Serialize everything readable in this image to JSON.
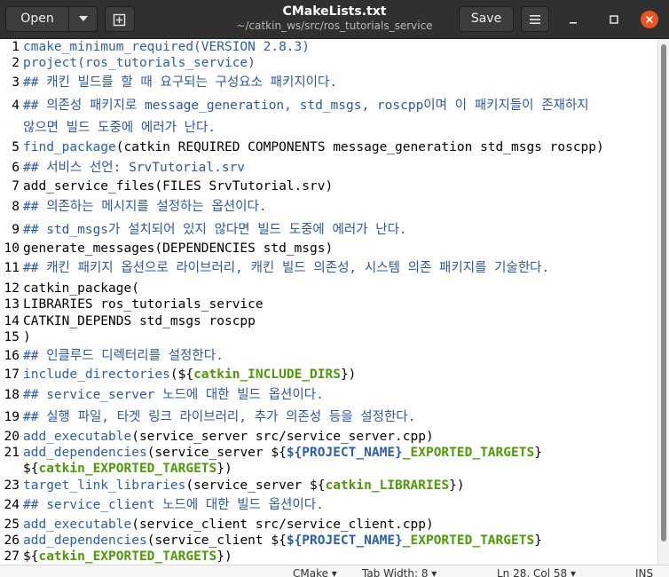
{
  "header": {
    "open_label": "Open",
    "save_label": "Save",
    "title": "CMakeLists.txt",
    "subtitle": "~/catkin_ws/src/ros_tutorials_service"
  },
  "icons": [
    "chevron-down-icon",
    "new-tab-icon",
    "hamburger-menu-icon",
    "minimize-icon",
    "maximize-icon",
    "close-icon"
  ],
  "colors": {
    "headerbar": "#303030",
    "keyword": "#2a5fb0",
    "variable": "#4e9a06",
    "close": "#e95420"
  },
  "editor": {
    "lines": [
      {
        "n": "1",
        "t": "cmake_minimum_required(VERSION 2.8.3)"
      },
      {
        "n": "2",
        "t": "project(ros_tutorials_service)"
      },
      {
        "n": "3",
        "t": "## 캐킨 빌드를 할 때 요구되는 구성요소 패키지이다."
      },
      {
        "n": "4",
        "t": "## 의존성 패키지로 message_generation, std_msgs, roscpp이며 이 패키지들이 존재하지"
      },
      {
        "n": "",
        "t": "않으면 빌드 도중에 에러가 난다."
      },
      {
        "n": "5",
        "t": "find_package(catkin REQUIRED COMPONENTS message_generation std_msgs roscpp)"
      },
      {
        "n": "6",
        "t": "## 서비스 선언: SrvTutorial.srv"
      },
      {
        "n": "7",
        "t": "add_service_files(FILES SrvTutorial.srv)"
      },
      {
        "n": "8",
        "t": "## 의존하는 메시지를 설정하는 옵션이다."
      },
      {
        "n": "9",
        "t": "## std_msgs가 설치되어 있지 않다면 빌드 도중에 에러가 난다."
      },
      {
        "n": "10",
        "t": "generate_messages(DEPENDENCIES std_msgs)"
      },
      {
        "n": "11",
        "t": "## 캐킨 패키지 옵션으로 라이브러리, 캐킨 빌드 의존성, 시스템 의존 패키지를 기술한다."
      },
      {
        "n": "12",
        "t": "catkin_package("
      },
      {
        "n": "13",
        "t": "LIBRARIES ros_tutorials_service"
      },
      {
        "n": "14",
        "t": "CATKIN_DEPENDS std_msgs roscpp"
      },
      {
        "n": "15",
        "t": ")"
      },
      {
        "n": "16",
        "t": "## 인클루드 디렉터리를 설정한다."
      },
      {
        "n": "17",
        "t": "include_directories(${catkin_INCLUDE_DIRS})"
      },
      {
        "n": "18",
        "t": "## service_server 노드에 대한 빌드 옵션이다."
      },
      {
        "n": "19",
        "t": "## 실행 파일, 타겟 링크 라이브러리, 추가 의존성 등을 설정한다."
      },
      {
        "n": "20",
        "t": "add_executable(service_server src/service_server.cpp)"
      },
      {
        "n": "21",
        "t": "add_dependencies(service_server ${${PROJECT_NAME}_EXPORTED_TARGETS}"
      },
      {
        "n": "",
        "t": "${catkin_EXPORTED_TARGETS})"
      },
      {
        "n": "23",
        "t": "target_link_libraries(service_server ${catkin_LIBRARIES})"
      },
      {
        "n": "24",
        "t": "## service_client 노드에 대한 빌드 옵션이다."
      },
      {
        "n": "25",
        "t": "add_executable(service_client src/service_client.cpp)"
      },
      {
        "n": "26",
        "t": "add_dependencies(service_client ${${PROJECT_NAME}_EXPORTED_TARGETS}"
      },
      {
        "n": "27",
        "t": "${catkin_EXPORTED_TARGETS})"
      }
    ]
  },
  "statusbar": {
    "language": "CMake ▾",
    "tab_width": "Tab Width: 8 ▾",
    "position": "Ln 28, Col 58 ▾",
    "mode": "INS"
  }
}
